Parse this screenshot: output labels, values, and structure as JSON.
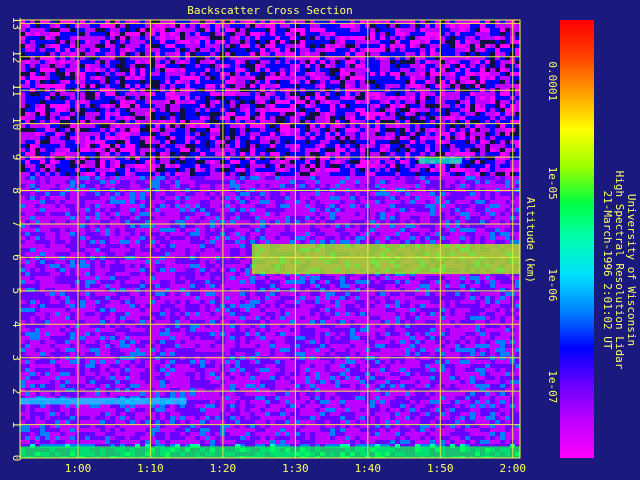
{
  "chart_data": {
    "type": "heatmap",
    "title": "Backscatter Cross Section",
    "ylabel": "Altitude (km)",
    "xlabel": "",
    "x_ticks": [
      "1:00",
      "1:10",
      "1:20",
      "1:30",
      "1:40",
      "1:50",
      "2:00"
    ],
    "x_tick_minutes": [
      60,
      70,
      80,
      90,
      100,
      110,
      120
    ],
    "xlim_minutes": [
      52,
      121
    ],
    "y_ticks": [
      0,
      1,
      2,
      3,
      4,
      5,
      6,
      7,
      8,
      9,
      10,
      11,
      12,
      13
    ],
    "ylim": [
      0,
      13.1
    ],
    "grid": true,
    "colorbar": {
      "scale": "log",
      "range": [
        2e-08,
        0.0004
      ],
      "tick_labels": [
        "0.0001",
        "1e-05",
        "1e-06",
        "1e-07"
      ],
      "tick_values": [
        0.0001,
        1e-05,
        1e-06,
        1e-07
      ],
      "colors": [
        "#ff00ff",
        "#c000ff",
        "#6a00ff",
        "#0000ff",
        "#0080ff",
        "#00e0ff",
        "#00ffb0",
        "#00ff40",
        "#a0ff00",
        "#ffff00",
        "#ffa000",
        "#ff4000",
        "#ff0000"
      ]
    },
    "features": [
      {
        "name": "surface layer",
        "x_minutes": [
          52,
          121
        ],
        "altitude_km": [
          0,
          0.35
        ],
        "level": 0.55
      },
      {
        "name": "boundary layer band",
        "x_minutes": [
          52,
          75
        ],
        "altitude_km": [
          1.6,
          1.8
        ],
        "level": 0.45
      },
      {
        "name": "cloud layer",
        "x_minutes": [
          84,
          121
        ],
        "altitude_km": [
          5.5,
          6.4
        ],
        "level": 0.65
      },
      {
        "name": "high cloud",
        "x_minutes": [
          107,
          113
        ],
        "altitude_km": [
          8.8,
          9.0
        ],
        "level": 0.5
      }
    ]
  },
  "annotation": {
    "lines": [
      "University of Wisconsin",
      "High Spectral Resolution Lidar",
      "21-March-1996  2:01:02 UT"
    ]
  },
  "colors": {
    "background": "#1a1a7e",
    "axis": "#ffff40",
    "grid": "#e8e840",
    "text": "#ffff66"
  }
}
